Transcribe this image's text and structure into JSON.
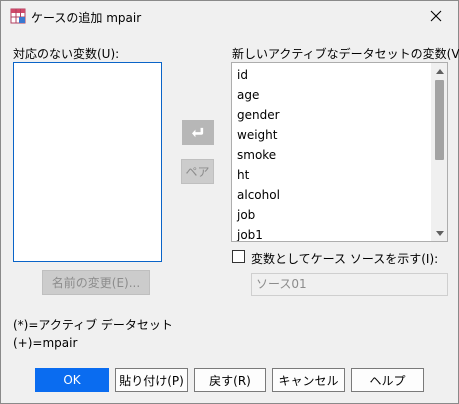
{
  "window": {
    "title": "ケースの追加 mpair",
    "close_icon": "close-icon",
    "app_icon": "table-icon"
  },
  "unpaired": {
    "label": "対応のない変数(U):",
    "items": []
  },
  "new_dataset": {
    "label": "新しいアクティブなデータセットの変数(V):",
    "items": [
      "id",
      "age",
      "gender",
      "weight",
      "smoke",
      "ht",
      "alcohol",
      "job",
      "job1"
    ]
  },
  "buttons": {
    "move_arrow_icon": "arrow-left-icon",
    "pair": "ペア",
    "rename": "名前の変更(E)...",
    "ok": "OK",
    "paste": "貼り付け(P)",
    "reset": "戻す(R)",
    "cancel": "キャンセル",
    "help": "ヘルプ"
  },
  "source_option": {
    "checkbox_label": "変数としてケース ソースを示す(I):",
    "checked": false,
    "field_value": "ソース01"
  },
  "legend": {
    "active": "(*)=アクティブ データセット",
    "plus": "(+)=mpair"
  },
  "colors": {
    "accent": "#0a6cf0",
    "dialog_bg": "#f0f0f0"
  }
}
